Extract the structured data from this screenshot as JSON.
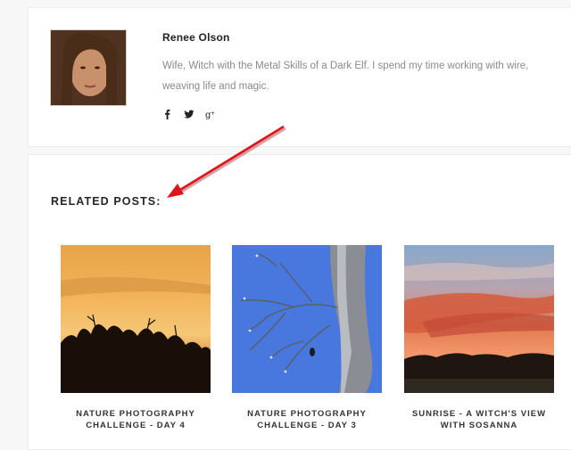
{
  "author": {
    "name": "Renee Olson",
    "bio": "Wife, Witch with the Metal Skills of a Dark Elf. I spend my time working with wire, weaving life and magic.",
    "social": [
      "facebook-icon",
      "twitter-icon",
      "google-plus-icon"
    ]
  },
  "related": {
    "heading": "RELATED POSTS:",
    "posts": [
      {
        "title": "NATURE PHOTOGRAPHY CHALLENGE - DAY 4"
      },
      {
        "title": "NATURE PHOTOGRAPHY CHALLENGE - DAY 3"
      },
      {
        "title": "SUNRISE - A WITCH'S VIEW WITH SOSANNA"
      }
    ]
  },
  "colors": {
    "arrow": "#e0141b",
    "heading": "#262626",
    "bio_text": "#8a8a8a"
  }
}
